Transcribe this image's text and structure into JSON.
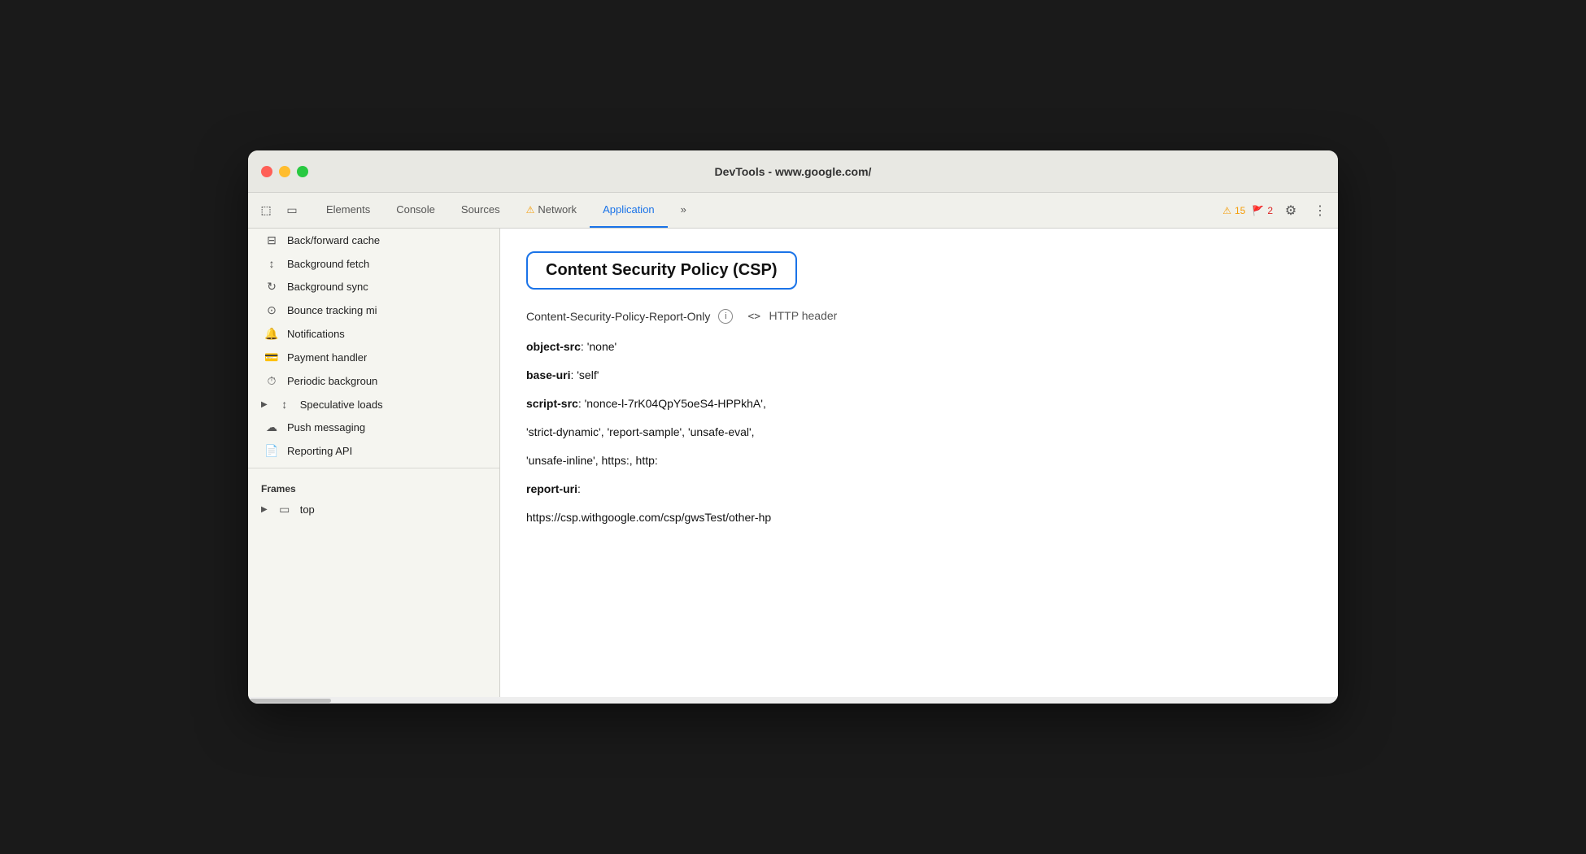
{
  "window": {
    "title": "DevTools - www.google.com/"
  },
  "toolbar": {
    "icons": [
      {
        "name": "cursor-icon",
        "symbol": "⬚"
      },
      {
        "name": "device-icon",
        "symbol": "▭"
      }
    ],
    "tabs": [
      {
        "id": "elements",
        "label": "Elements",
        "active": false,
        "warning": false
      },
      {
        "id": "console",
        "label": "Console",
        "active": false,
        "warning": false
      },
      {
        "id": "sources",
        "label": "Sources",
        "active": false,
        "warning": false
      },
      {
        "id": "network",
        "label": "Network",
        "active": false,
        "warning": true
      },
      {
        "id": "application",
        "label": "Application",
        "active": true,
        "warning": false
      }
    ],
    "more_tabs": "»",
    "warning_count": "15",
    "error_count": "2"
  },
  "sidebar": {
    "items": [
      {
        "id": "back-forward",
        "icon": "⊟",
        "label": "Back/forward cache"
      },
      {
        "id": "background-fetch",
        "icon": "↕",
        "label": "Background fetch"
      },
      {
        "id": "background-sync",
        "icon": "↻",
        "label": "Background sync"
      },
      {
        "id": "bounce-tracking",
        "icon": "⊙",
        "label": "Bounce tracking mi"
      },
      {
        "id": "notifications",
        "icon": "🔔",
        "label": "Notifications"
      },
      {
        "id": "payment-handler",
        "icon": "💳",
        "label": "Payment handler"
      },
      {
        "id": "periodic-background",
        "icon": "⏱",
        "label": "Periodic backgroun"
      },
      {
        "id": "speculative-loads",
        "icon": "↕",
        "label": "Speculative loads",
        "has_arrow": true
      },
      {
        "id": "push-messaging",
        "icon": "☁",
        "label": "Push messaging"
      },
      {
        "id": "reporting-api",
        "icon": "📄",
        "label": "Reporting API"
      }
    ],
    "frames_section": "Frames",
    "frames_item": "top"
  },
  "main": {
    "csp_title": "Content Security Policy (CSP)",
    "policy_name": "Content-Security-Policy-Report-Only",
    "policy_source": "HTTP header",
    "lines": [
      {
        "key": "object-src",
        "value": ": 'none'"
      },
      {
        "key": "base-uri",
        "value": ": 'self'"
      },
      {
        "key": "script-src",
        "value": ": 'nonce-l-7rK04QpY5oeS4-HPPkhA',"
      },
      {
        "key": null,
        "value": "'strict-dynamic', 'report-sample', 'unsafe-eval',"
      },
      {
        "key": null,
        "value": "'unsafe-inline', https:, http:"
      },
      {
        "key": "report-uri",
        "value": ":"
      },
      {
        "key": null,
        "value": "https://csp.withgoogle.com/csp/gwsTest/other-hp"
      }
    ]
  },
  "icons": {
    "cursor": "⬚",
    "device": "▭",
    "warning": "⚠",
    "settings": "⚙",
    "more": "⋮",
    "code": "<>",
    "info": "i",
    "folder": "📁",
    "arrow_right": "▶",
    "arrow_down": "▼"
  }
}
